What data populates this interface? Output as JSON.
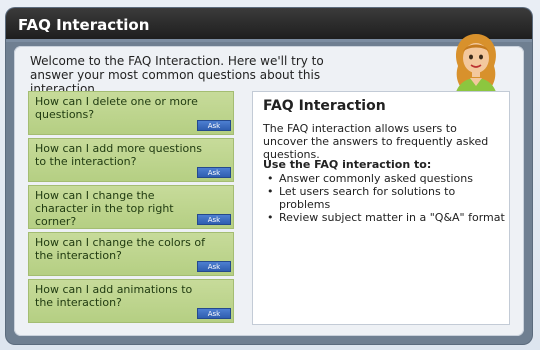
{
  "window": {
    "title": "FAQ Interaction"
  },
  "intro": {
    "text": "Welcome to the FAQ Interaction. Here we'll try to answer your most common questions about this interaction."
  },
  "faq": {
    "ask_label": "Ask",
    "questions": [
      {
        "label": "How can I delete one or more questions?"
      },
      {
        "label": "How can I add more questions to the interaction?"
      },
      {
        "label": "How can I change the character in the top right corner?"
      },
      {
        "label": "How can I change the  colors of the interaction?"
      },
      {
        "label": "How can I add animations to the interaction?"
      }
    ]
  },
  "content": {
    "heading": "FAQ Interaction",
    "description": "The FAQ interaction allows users to uncover the answers to frequently asked questions.",
    "subheading": "Use the FAQ interaction to:",
    "bullets": [
      "Answer commonly asked questions",
      "Let users search for solutions to problems",
      "Review subject matter in a \"Q&A\" format"
    ]
  },
  "colors": {
    "titlebar": "#2b2b2b",
    "question_bg": "#c0d690",
    "ask_button": "#3a6ac0",
    "frame": "#6f7f91"
  },
  "icons": {
    "character": "woman-avatar-icon"
  }
}
